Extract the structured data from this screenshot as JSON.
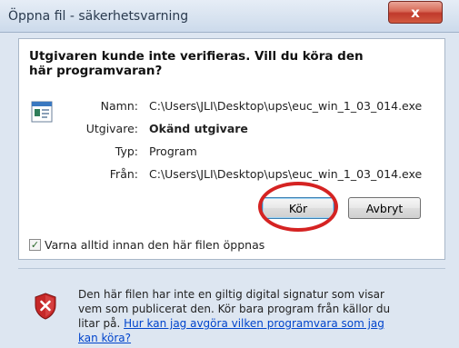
{
  "window": {
    "title": "Öppna fil - säkerhetsvarning",
    "close_label": "x"
  },
  "dialog": {
    "heading": "Utgivaren kunde inte verifieras. Vill du köra den här programvaran?",
    "fields": {
      "name_label": "Namn:",
      "name_value": "C:\\Users\\JLI\\Desktop\\ups\\euc_win_1_03_014.exe",
      "publisher_label": "Utgivare:",
      "publisher_value": "Okänd utgivare",
      "type_label": "Typ:",
      "type_value": "Program",
      "from_label": "Från:",
      "from_value": "C:\\Users\\JLI\\Desktop\\ups\\euc_win_1_03_014.exe"
    },
    "buttons": {
      "run": "Kör",
      "cancel": "Avbryt"
    },
    "checkbox": {
      "label": "Varna alltid innan den här filen öppnas",
      "checked": true,
      "mark": "✓"
    },
    "warning": {
      "text": "Den här filen har inte en giltig digital signatur som visar vem som publicerat den. Kör bara program från källor du litar på.",
      "link": "Hur kan jag avgöra vilken programvara som jag kan köra?"
    }
  },
  "colors": {
    "annotation_circle": "#d52322",
    "link": "#0044cc",
    "close_button": "#c0392b"
  },
  "icons": [
    "program-file-icon",
    "security-shield-icon",
    "close-icon",
    "checkmark-icon"
  ]
}
